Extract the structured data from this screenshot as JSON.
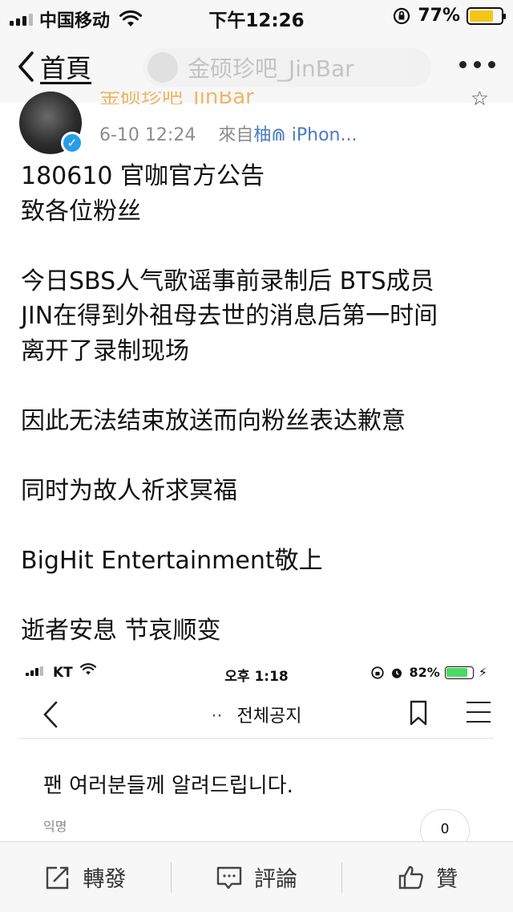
{
  "status_bar": {
    "carrier": "中国移动",
    "time": "下午12:26",
    "battery_percent": "77%",
    "battery_level": 0.77,
    "battery_color": "#f5c518"
  },
  "nav": {
    "back_label": "首頁",
    "title": "金硕珍吧_JinBar"
  },
  "post": {
    "author_cut": "金硕珍吧_JinBar",
    "date": "6-10 12:24",
    "source_prefix": "來自",
    "source": "柚⋒ iPhon...",
    "paragraphs": [
      [
        "180610  官咖官方公告",
        "致各位粉丝"
      ],
      [
        "今日SBS人气歌谣事前录制后 BTS成员",
        "JIN在得到外祖母去世的消息后第一时间",
        "离开了录制现场"
      ],
      [
        "因此无法结束放送而向粉丝表达歉意"
      ],
      [
        "同时为故人祈求冥福"
      ],
      [
        "BigHit Entertainment敬上"
      ],
      [
        "逝者安息 节哀顺变"
      ]
    ]
  },
  "embed": {
    "carrier": "KT",
    "time": "오후 1:18",
    "battery_percent": "82%",
    "battery_level": 0.82,
    "title_dots": "··",
    "title": "전체공지",
    "headline": "팬 여러분들께 알려드립니다.",
    "author": "익명",
    "comment_count": "0"
  },
  "actions": {
    "repost": "轉發",
    "comment": "評論",
    "like": "贊"
  }
}
